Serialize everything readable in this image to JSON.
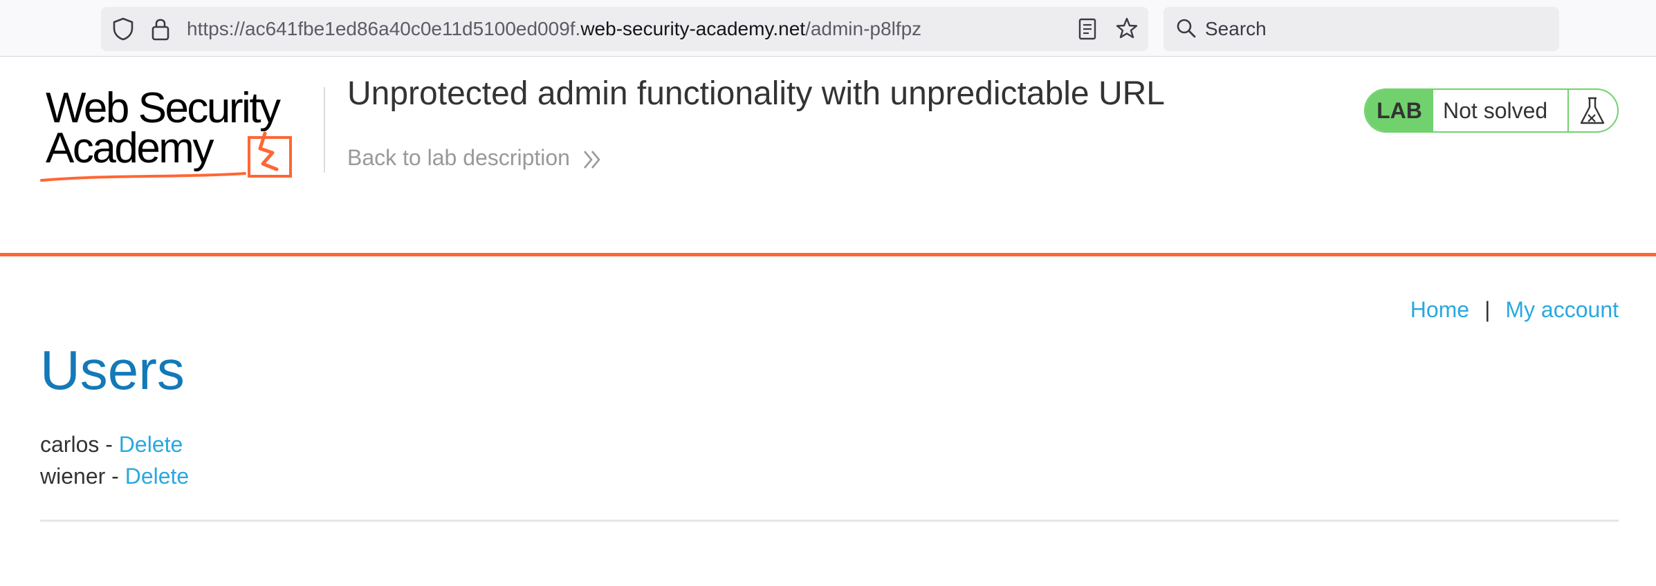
{
  "browser": {
    "url_prefix": "https://ac641fbe1ed86a40c0e11d5100ed009f.",
    "url_domain": "web-security-academy.net",
    "url_path": "/admin-p8lfpz",
    "search_placeholder": "Search"
  },
  "header": {
    "logo_line1": "Web Security",
    "logo_line2": "Academy",
    "lab_title": "Unprotected admin functionality with unpredictable URL",
    "back_link": "Back to lab description",
    "status_lab": "LAB",
    "status_text": "Not solved",
    "accent_color": "#ff6633",
    "status_color": "#70d16d"
  },
  "nav": {
    "home": "Home",
    "separator": "|",
    "my_account": "My account"
  },
  "main": {
    "heading": "Users",
    "users": [
      {
        "name": "carlos",
        "separator": " - ",
        "action": "Delete"
      },
      {
        "name": "wiener",
        "separator": " - ",
        "action": "Delete"
      }
    ]
  }
}
